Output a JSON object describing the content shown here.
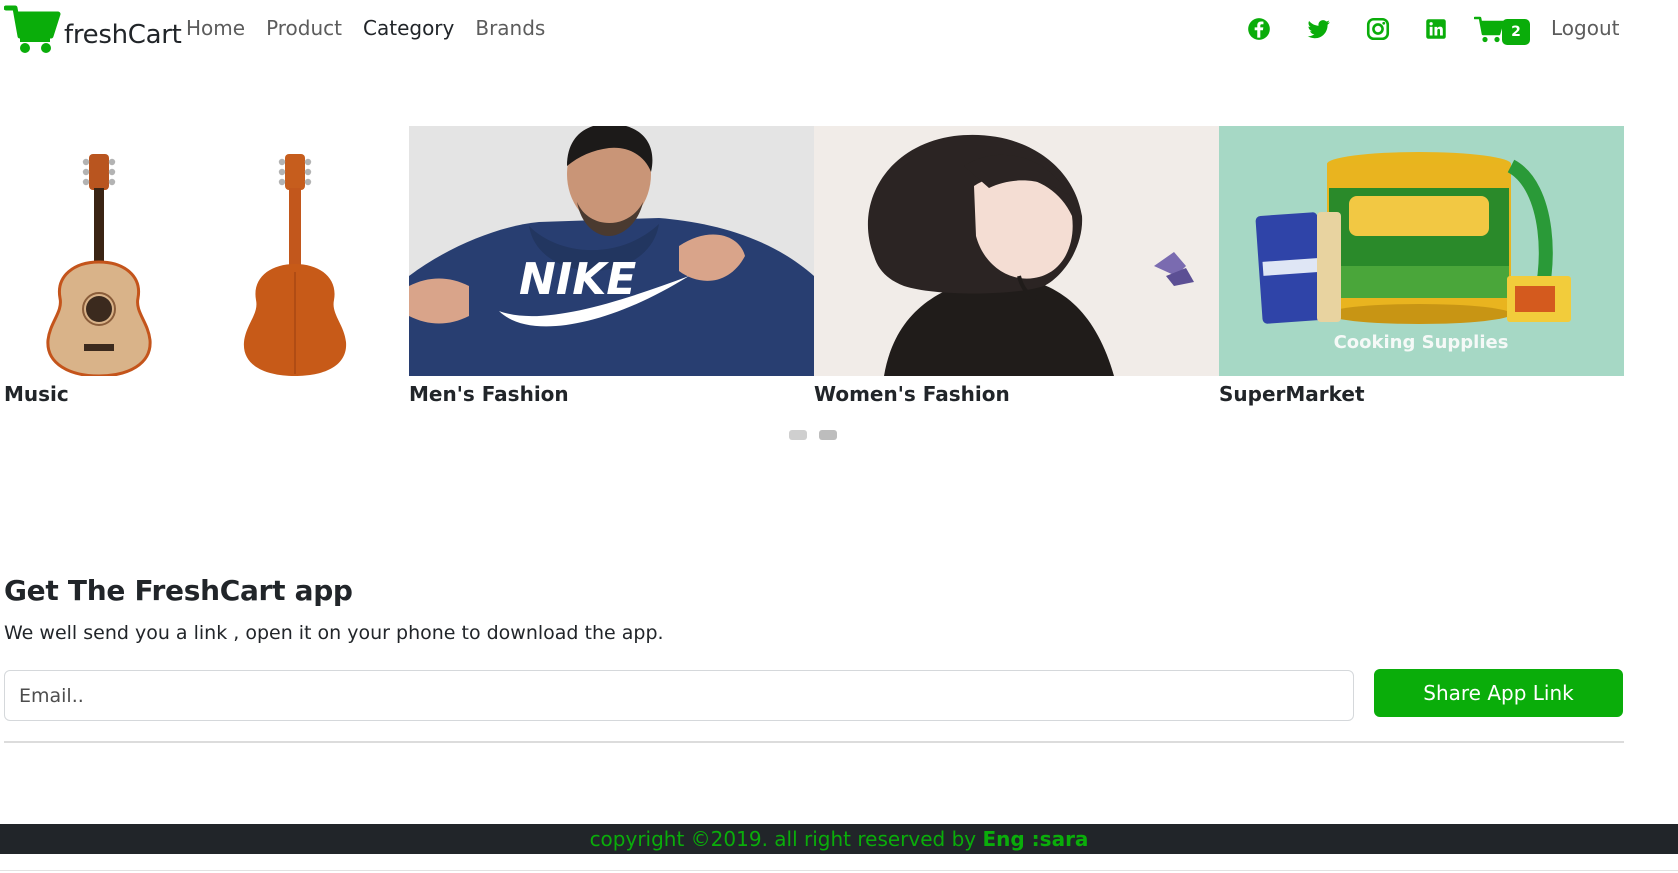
{
  "brand": {
    "name": "freshCart",
    "icon": "shopping-cart-icon",
    "color": "#0aad0a"
  },
  "nav": {
    "links": [
      {
        "label": "Home",
        "active": false
      },
      {
        "label": "Product",
        "active": false
      },
      {
        "label": "Category",
        "active": true
      },
      {
        "label": "Brands",
        "active": false
      }
    ],
    "social": [
      "facebook-icon",
      "twitter-icon",
      "instagram-icon",
      "linkedin-icon"
    ],
    "cart_count": "2",
    "logout_label": "Logout"
  },
  "categories": [
    {
      "label": "Music",
      "image": "guitar-photo"
    },
    {
      "label": "Men's Fashion",
      "image": "man-hoodie-photo"
    },
    {
      "label": "Women's Fashion",
      "image": "woman-illustration"
    },
    {
      "label": "SuperMarket",
      "image": "cooking-supplies-photo",
      "caption": "Cooking Supplies"
    }
  ],
  "slider": {
    "dots": 2,
    "active_dot": 2
  },
  "app_section": {
    "title": "Get The FreshCart app",
    "subtitle": "We well send you a link , open it on your phone to download the app.",
    "email_placeholder": "Email..",
    "button_label": "Share App Link"
  },
  "footer": {
    "text": "copyright ©2019. all right reserved by ",
    "author": "Eng :sara"
  },
  "colors": {
    "accent": "#0aad0a",
    "footer_bg": "#212529"
  }
}
